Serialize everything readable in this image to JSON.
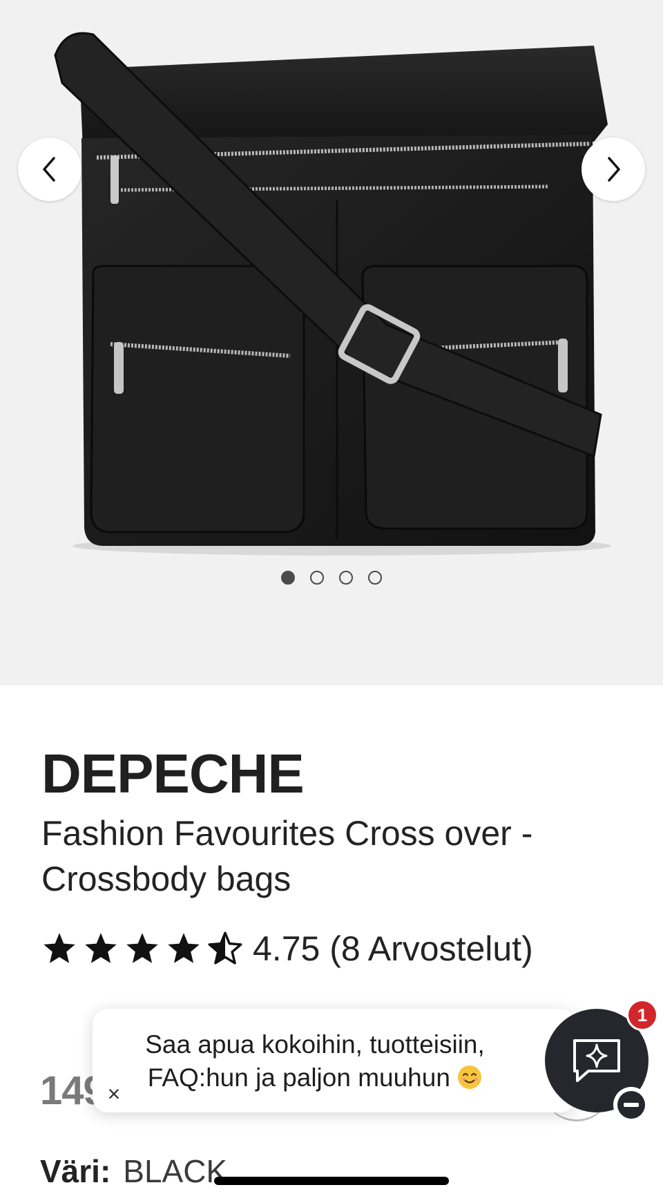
{
  "gallery": {
    "image_alt": "black leather crossbody bag",
    "prev_icon": "chevron-left-icon",
    "next_icon": "chevron-right-icon",
    "dots_total": 4,
    "active_dot": 1
  },
  "product": {
    "brand": "DEPECHE",
    "name": "Fashion Favourites Cross over - Crossbody bags",
    "rating_value": 4.75,
    "rating_text": "4.75 (8 Arvostelut)",
    "price_text": "149",
    "color_label": "Väri:",
    "color_value": "BLACK"
  },
  "chat": {
    "message": "Saa apua kokoihin, tuotteisiin, FAQ:hun ja paljon muuhun",
    "emoji": "smiling-face-emoji",
    "close_label": "×",
    "badge_count": "1",
    "launcher_icon": "sparkle-chat-icon",
    "minimize_icon": "minus-icon"
  },
  "colors": {
    "gallery_bg": "#f2f1f2",
    "chat_dark": "#26262d",
    "badge_red": "#d2272a"
  }
}
